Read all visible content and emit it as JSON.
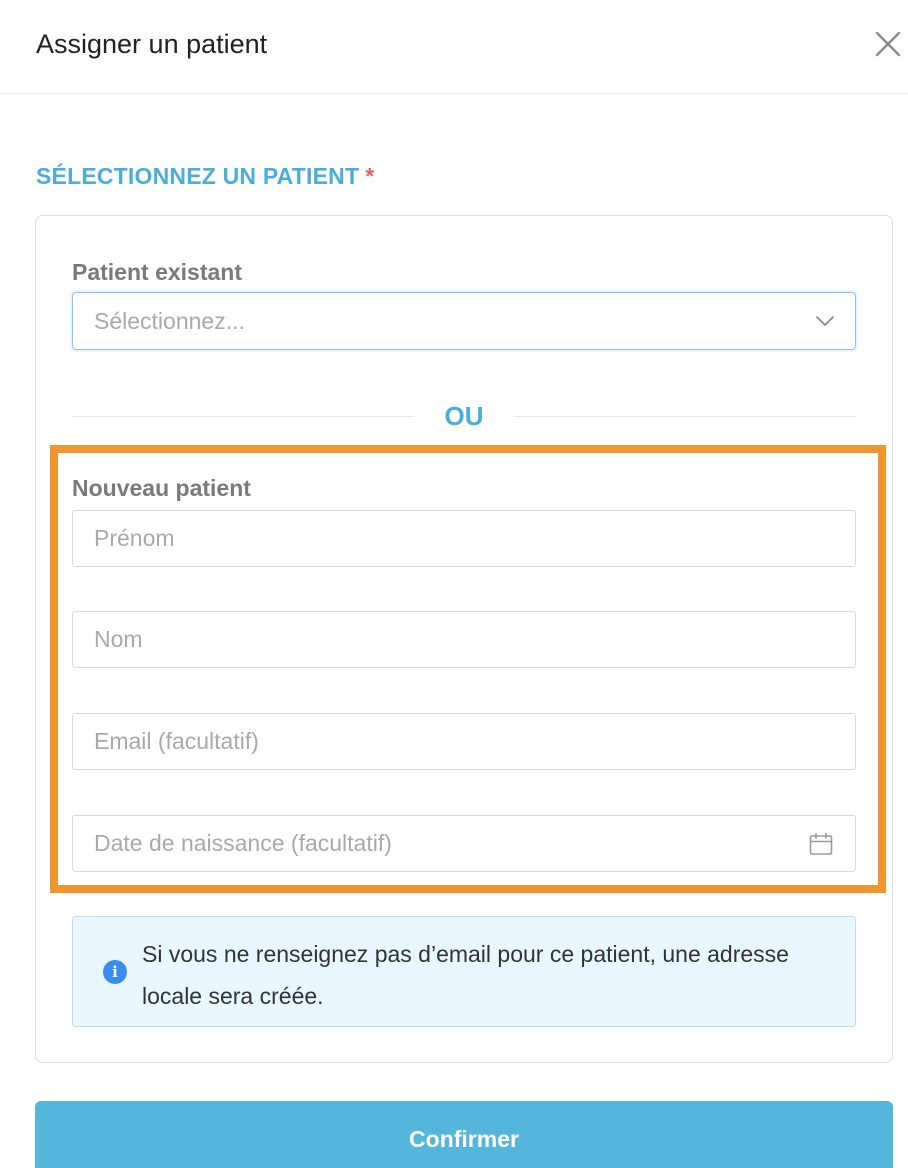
{
  "modal": {
    "title": "Assigner un patient",
    "close_icon": "close-icon"
  },
  "section": {
    "title": "SÉLECTIONNEZ UN PATIENT",
    "required_marker": "*"
  },
  "existing_patient": {
    "label": "Patient existant",
    "placeholder": "Sélectionnez...",
    "chevron_icon": "chevron-down-icon"
  },
  "divider": {
    "label": "OU"
  },
  "new_patient": {
    "label": "Nouveau patient",
    "first_name_placeholder": "Prénom",
    "last_name_placeholder": "Nom",
    "email_placeholder": "Email (facultatif)",
    "birthdate_placeholder": "Date de naissance (facultatif)",
    "calendar_icon": "calendar-icon"
  },
  "info": {
    "icon": "info-icon",
    "icon_glyph": "i",
    "text": "Si vous ne renseignez pas d’email pour ce patient, une adresse locale sera créée."
  },
  "actions": {
    "confirm_label": "Confirmer"
  },
  "colors": {
    "accent": "#4aaed8",
    "button": "#55b6dc",
    "highlight": "#f0962e",
    "required": "#e06666",
    "info_background": "#e8f7fd",
    "info_icon": "#3b8cf0"
  }
}
